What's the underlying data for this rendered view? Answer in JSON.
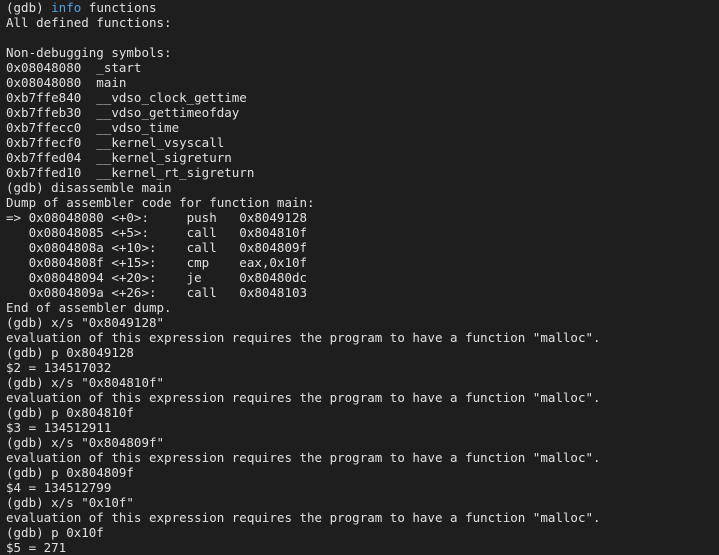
{
  "colors": {
    "background": "#1e1e1e",
    "text": "#e0e0e0",
    "keyword": "#4fa3e0"
  },
  "lines": [
    [
      "(gdb) ",
      "info",
      " functions"
    ],
    "All defined functions:",
    "",
    "Non-debugging symbols:",
    "0x08048080  _start",
    "0x08048080  main",
    "0xb7ffe840  __vdso_clock_gettime",
    "0xb7ffeb30  __vdso_gettimeofday",
    "0xb7ffecc0  __vdso_time",
    "0xb7ffecf0  __kernel_vsyscall",
    "0xb7ffed04  __kernel_sigreturn",
    "0xb7ffed10  __kernel_rt_sigreturn",
    "(gdb) disassemble main",
    "Dump of assembler code for function main:",
    "=> 0x08048080 <+0>:     push   0x8049128",
    "   0x08048085 <+5>:     call   0x804810f",
    "   0x0804808a <+10>:    call   0x804809f",
    "   0x0804808f <+15>:    cmp    eax,0x10f",
    "   0x08048094 <+20>:    je     0x80480dc",
    "   0x0804809a <+26>:    call   0x8048103",
    "End of assembler dump.",
    "(gdb) x/s \"0x8049128\"",
    "evaluation of this expression requires the program to have a function \"malloc\".",
    "(gdb) p 0x8049128",
    "$2 = 134517032",
    "(gdb) x/s \"0x804810f\"",
    "evaluation of this expression requires the program to have a function \"malloc\".",
    "(gdb) p 0x804810f",
    "$3 = 134512911",
    "(gdb) x/s \"0x804809f\"",
    "evaluation of this expression requires the program to have a function \"malloc\".",
    "(gdb) p 0x804809f",
    "$4 = 134512799",
    "(gdb) x/s \"0x10f\"",
    "evaluation of this expression requires the program to have a function \"malloc\".",
    "(gdb) p 0x10f",
    "$5 = 271"
  ]
}
